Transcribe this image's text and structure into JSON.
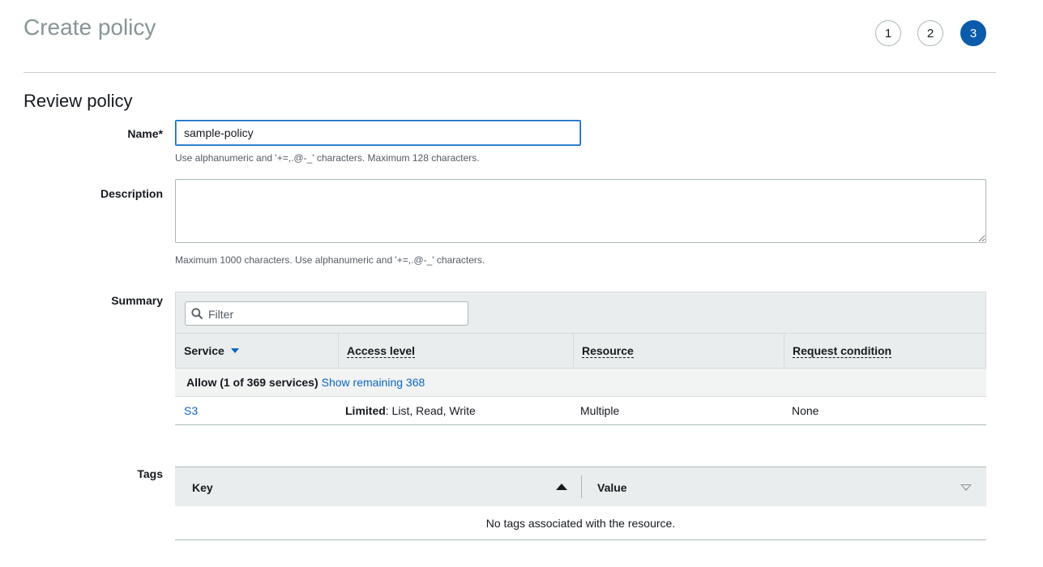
{
  "header": {
    "title": "Create policy",
    "steps": [
      "1",
      "2",
      "3"
    ],
    "active_step": 3
  },
  "review": {
    "section_title": "Review policy",
    "name_label": "Name*",
    "name_value": "sample-policy",
    "name_hint": "Use alphanumeric and '+=,.@-_' characters. Maximum 128 characters.",
    "description_label": "Description",
    "description_value": "",
    "description_hint": "Maximum 1000 characters. Use alphanumeric and '+=,.@-_' characters."
  },
  "summary": {
    "label": "Summary",
    "filter_placeholder": "Filter",
    "columns": [
      "Service",
      "Access level",
      "Resource",
      "Request condition"
    ],
    "group": {
      "text": "Allow (1 of 369 services)",
      "link": "Show remaining 368"
    },
    "rows": [
      {
        "service": "S3",
        "access_level_bold": "Limited",
        "access_level_rest": ": List, Read, Write",
        "resource": "Multiple",
        "request_condition": "None"
      }
    ]
  },
  "tags": {
    "label": "Tags",
    "columns": [
      "Key",
      "Value"
    ],
    "empty_text": "No tags associated with the resource."
  },
  "colors": {
    "accent": "#0b5bab",
    "link": "#0b66c3",
    "header_bg": "#eaeded"
  }
}
